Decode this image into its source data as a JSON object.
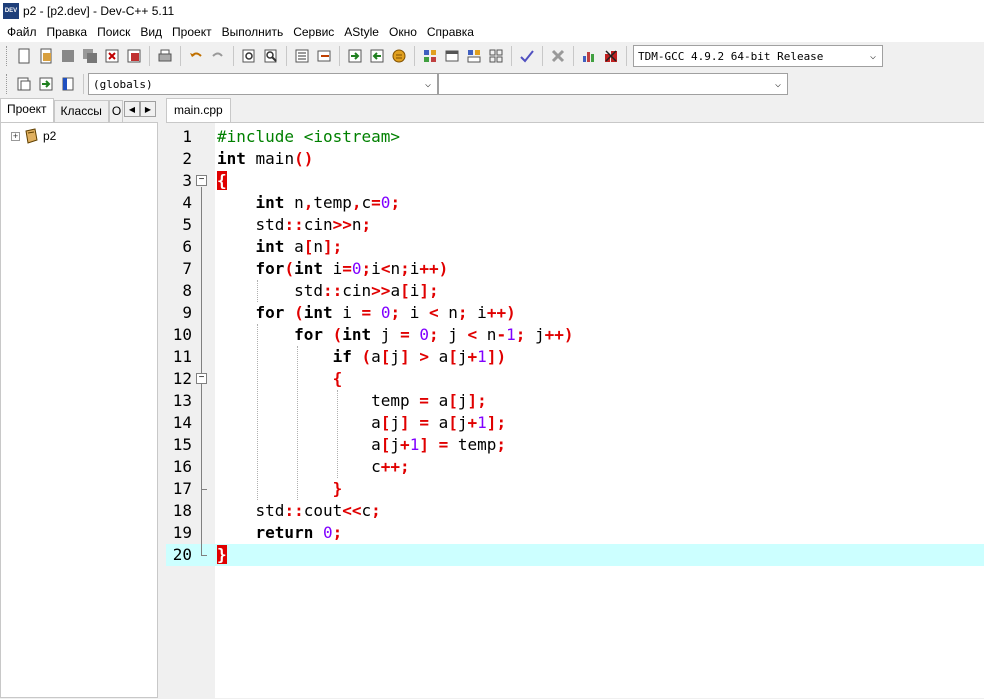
{
  "window": {
    "title": "p2 - [p2.dev] - Dev-C++ 5.11",
    "icon": "dev-cpp-app-icon",
    "icon_text": "DEV"
  },
  "menu": [
    "Файл",
    "Правка",
    "Поиск",
    "Вид",
    "Проект",
    "Выполнить",
    "Сервис",
    "AStyle",
    "Окно",
    "Справка"
  ],
  "toolbar": {
    "compiler_selected": "TDM-GCC 4.9.2 64-bit Release",
    "buttons": [
      "new-file",
      "open-file",
      "save",
      "save-all",
      "close",
      "print",
      "undo",
      "redo",
      "find",
      "replace",
      "indent",
      "unindent",
      "goto",
      "insert",
      "compile",
      "run",
      "compile-run",
      "rebuild",
      "debug",
      "stop",
      "chart",
      "profile"
    ]
  },
  "toolbar2": {
    "scope_selected": "(globals)",
    "member_selected": ""
  },
  "left_panel": {
    "tabs": [
      "Проект",
      "Классы",
      "О"
    ],
    "tree": [
      {
        "label": "p2",
        "icon": "project-icon"
      }
    ]
  },
  "editor": {
    "tab": "main.cpp",
    "current_line": 20,
    "lines": [
      "#include <iostream>",
      "int main()",
      "{",
      "    int n,temp,c=0;",
      "    std::cin>>n;",
      "    int a[n];",
      "    for(int i=0;i<n;i++)",
      "        std::cin>>a[i];",
      "    for (int i = 0; i < n; i++)",
      "        for (int j = 0; j < n-1; j++)",
      "            if (a[j] > a[j+1])",
      "            {",
      "                temp = a[j];",
      "                a[j] = a[j+1];",
      "                a[j+1] = temp;",
      "                c++;",
      "            }",
      "    std::cout<<c;",
      "    return 0;",
      "}"
    ]
  }
}
